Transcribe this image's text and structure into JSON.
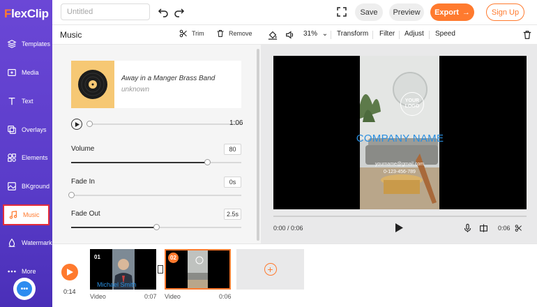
{
  "app": {
    "logo_first": "F",
    "logo_rest": "lexClip"
  },
  "sidebar": {
    "items": [
      {
        "label": "Templates",
        "icon": "layers-icon"
      },
      {
        "label": "Media",
        "icon": "media-icon"
      },
      {
        "label": "Text",
        "icon": "text-icon"
      },
      {
        "label": "Overlays",
        "icon": "overlays-icon"
      },
      {
        "label": "Elements",
        "icon": "elements-icon"
      },
      {
        "label": "BKground",
        "icon": "background-icon"
      },
      {
        "label": "Music",
        "icon": "music-icon",
        "active": true
      },
      {
        "label": "Watermark",
        "icon": "watermark-icon"
      },
      {
        "label": "More",
        "icon": "more-icon"
      }
    ]
  },
  "topbar": {
    "title_placeholder": "Untitled",
    "save_label": "Save",
    "preview_label": "Preview",
    "export_label": "Export",
    "signup_label": "Sign Up"
  },
  "music_panel": {
    "title": "Music",
    "trim_label": "Trim",
    "remove_label": "Remove",
    "track_title": "Away in a Manger Brass Band",
    "track_artist": "unknown",
    "track_duration": "1:06",
    "volume_label": "Volume",
    "volume_value": "80",
    "fade_in_label": "Fade In",
    "fade_in_value": "0s",
    "fade_out_label": "Fade Out",
    "fade_out_value": "2.5s"
  },
  "editor_toolbar": {
    "zoom": "31%",
    "transform_label": "Transform",
    "filter_label": "Filter",
    "adjust_label": "Adjust",
    "speed_label": "Speed"
  },
  "preview": {
    "logo_text": "YOUR LOGO",
    "company_name": "COMPANY NAME",
    "email": "yourname@gmail.com",
    "phone": "0-123-456-789",
    "current_time": "0:00 / 0:06",
    "clip_duration": "0:06"
  },
  "timeline": {
    "total_time": "0:14",
    "clips": [
      {
        "number": "01",
        "type": "Video",
        "duration": "0:07",
        "caption": "Michael Smith"
      },
      {
        "number": "02",
        "type": "Video",
        "duration": "0:06"
      }
    ],
    "add_label": "+"
  },
  "colors": {
    "accent": "#ff7a2e",
    "sidebar": "#5a3cc9",
    "brand_blue": "#2a8fe0"
  }
}
